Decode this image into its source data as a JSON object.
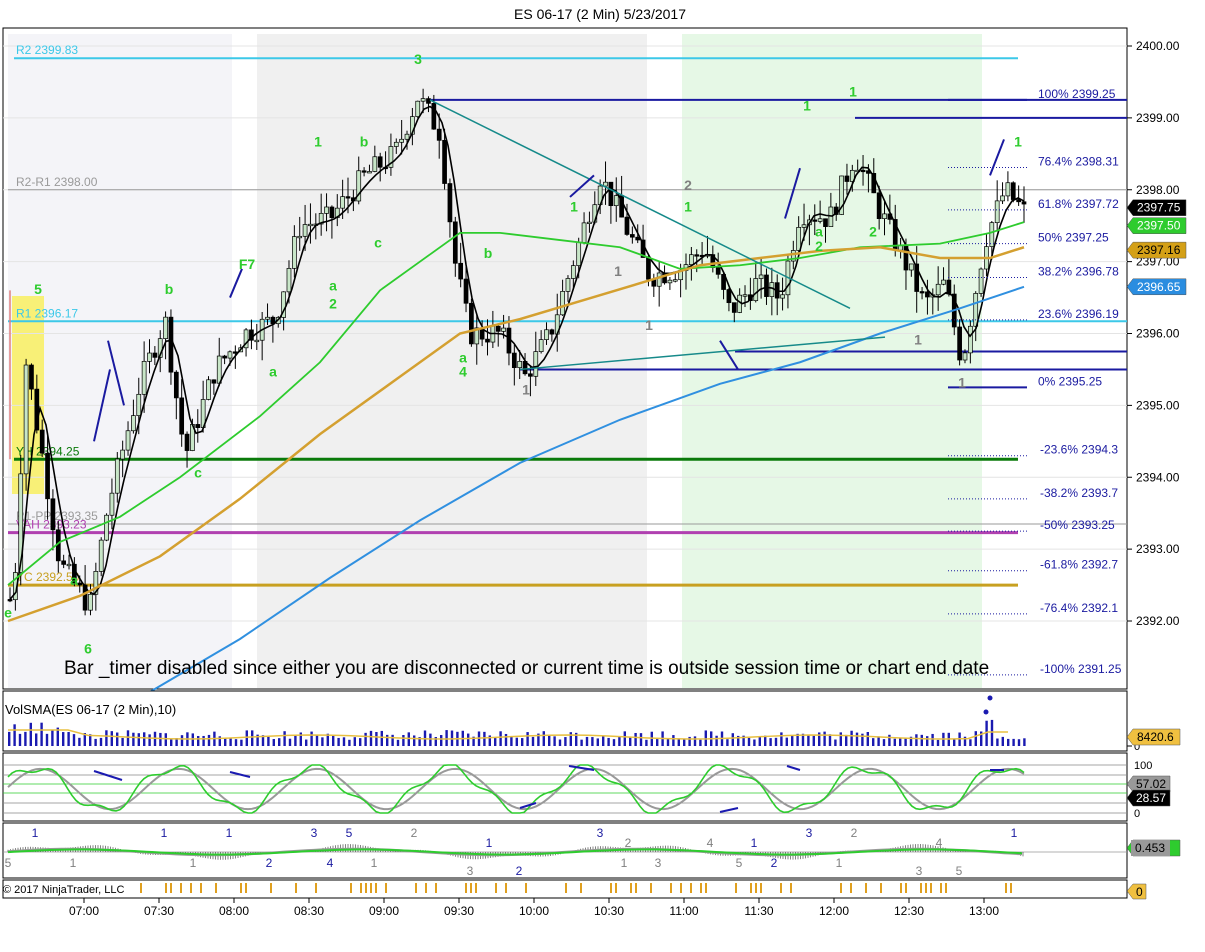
{
  "window": {
    "title": "ES 06-17 (2 Min)  5/23/2017"
  },
  "chart_data": {
    "type": "candlestick",
    "title": "ES 06-17 (2 Min)  5/23/2017",
    "price_axis": {
      "ylim": [
        2390.85,
        2400.3
      ],
      "ticks": [
        "2400.00",
        "2399.00",
        "2398.00",
        "2397.00",
        "2396.00",
        "2395.00",
        "2394.00",
        "2393.00",
        "2392.00"
      ]
    },
    "time_axis": {
      "ticks": [
        "07:00",
        "07:30",
        "08:00",
        "08:30",
        "09:00",
        "09:30",
        "10:00",
        "10:30",
        "11:00",
        "11:30",
        "12:00",
        "12:30",
        "13:00"
      ]
    },
    "levels": [
      {
        "label": "R2 2399.83",
        "price": 2399.83,
        "color": "#3cc8e8"
      },
      {
        "label": "R2-R1 2398.00",
        "price": 2398.0,
        "color": "#9a9a9a"
      },
      {
        "label": "R1 2396.17",
        "price": 2396.17,
        "color": "#3cc8e8"
      },
      {
        "label": "YH 2394.25",
        "price": 2394.25,
        "color": "#0a7a0a"
      },
      {
        "label": "R1-PP 2393.35",
        "price": 2393.35,
        "color": "#9a9a9a"
      },
      {
        "label": "VAH 2393.23",
        "price": 2393.23,
        "color": "#b040b0"
      },
      {
        "label": "YC 2392.50",
        "price": 2392.5,
        "color": "#c8a020"
      }
    ],
    "fibonacci": [
      {
        "label": "100%  2399.25",
        "price": 2399.25
      },
      {
        "label": "76.4%  2398.31",
        "price": 2398.31
      },
      {
        "label": "61.8%  2397.72",
        "price": 2397.72
      },
      {
        "label": "50%  2397.25",
        "price": 2397.25
      },
      {
        "label": "38.2%  2396.78",
        "price": 2396.78
      },
      {
        "label": "23.6%  2396.19",
        "price": 2396.19
      },
      {
        "label": "0%  2395.25",
        "price": 2395.25
      },
      {
        "label": "-23.6%  2394.3",
        "price": 2394.3
      },
      {
        "label": "-38.2%  2393.7",
        "price": 2393.7
      },
      {
        "label": "-50%  2393.25",
        "price": 2393.25
      },
      {
        "label": "-61.8%  2392.7",
        "price": 2392.7
      },
      {
        "label": "-76.4%  2392.1",
        "price": 2392.1
      },
      {
        "label": "-100%  2391.25",
        "price": 2391.25
      }
    ],
    "price_tags": [
      {
        "label": "2397.75",
        "bg": "#000000",
        "fg": "#ffffff",
        "price": 2397.75
      },
      {
        "label": "2397.50",
        "bg": "#2ecc2e",
        "fg": "#ffffff",
        "price": 2397.5
      },
      {
        "label": "2397.16",
        "bg": "#d4a017",
        "fg": "#000000",
        "price": 2397.16
      },
      {
        "label": "2396.65",
        "bg": "#2a8de0",
        "fg": "#ffffff",
        "price": 2396.65
      }
    ],
    "ohlc_path": [
      [
        -2,
        2392.0
      ],
      [
        14,
        2392.4
      ],
      [
        26,
        2395.6
      ],
      [
        40,
        2394.5
      ],
      [
        60,
        2392.8
      ],
      [
        90,
        2392.2
      ],
      [
        108,
        2393.6
      ],
      [
        140,
        2395.3
      ],
      [
        165,
        2396.2
      ],
      [
        185,
        2394.3
      ],
      [
        215,
        2395.5
      ],
      [
        245,
        2396.0
      ],
      [
        275,
        2396.2
      ],
      [
        300,
        2397.5
      ],
      [
        330,
        2397.6
      ],
      [
        365,
        2398.2
      ],
      [
        395,
        2398.5
      ],
      [
        418,
        2399.3
      ],
      [
        440,
        2398.8
      ],
      [
        455,
        2397.0
      ],
      [
        470,
        2396.0
      ],
      [
        500,
        2396.0
      ],
      [
        525,
        2395.4
      ],
      [
        550,
        2396.0
      ],
      [
        580,
        2397.3
      ],
      [
        600,
        2398.2
      ],
      [
        625,
        2397.5
      ],
      [
        650,
        2396.8
      ],
      [
        680,
        2396.9
      ],
      [
        705,
        2397.2
      ],
      [
        730,
        2396.3
      ],
      [
        755,
        2396.7
      ],
      [
        780,
        2396.5
      ],
      [
        800,
        2397.7
      ],
      [
        830,
        2397.6
      ],
      [
        855,
        2398.5
      ],
      [
        880,
        2397.7
      ],
      [
        905,
        2397.0
      ],
      [
        925,
        2396.4
      ],
      [
        945,
        2396.7
      ],
      [
        962,
        2395.6
      ],
      [
        985,
        2397.3
      ],
      [
        1005,
        2398.0
      ],
      [
        1024,
        2397.7
      ]
    ],
    "candle_count": 190,
    "annotations": [
      {
        "text": "3",
        "color": "#2ecc2e",
        "x": 418,
        "y": 2399.75
      },
      {
        "text": "1",
        "color": "#2ecc2e",
        "x": 318,
        "y": 2398.6
      },
      {
        "text": "b",
        "color": "#2ecc2e",
        "x": 364,
        "y": 2398.6
      },
      {
        "text": "c",
        "color": "#2ecc2e",
        "x": 378,
        "y": 2397.2
      },
      {
        "text": "a",
        "color": "#2ecc2e",
        "x": 333,
        "y": 2396.6
      },
      {
        "text": "2",
        "color": "#2ecc2e",
        "x": 333,
        "y": 2396.35
      },
      {
        "text": "a",
        "color": "#2ecc2e",
        "x": 273,
        "y": 2395.4
      },
      {
        "text": "F7",
        "color": "#2ecc2e",
        "x": 247,
        "y": 2396.9
      },
      {
        "text": "b",
        "color": "#2ecc2e",
        "x": 169,
        "y": 2396.55
      },
      {
        "text": "c",
        "color": "#2ecc2e",
        "x": 198,
        "y": 2394.0
      },
      {
        "text": "5",
        "color": "#2ecc2e",
        "x": 38,
        "y": 2396.55
      },
      {
        "text": "a",
        "color": "#2ecc2e",
        "x": 74,
        "y": 2392.5
      },
      {
        "text": "6",
        "color": "#2ecc2e",
        "x": 88,
        "y": 2391.55
      },
      {
        "text": "e",
        "color": "#2ecc2e",
        "x": 8,
        "y": 2392.05
      },
      {
        "text": "b",
        "color": "#2ecc2e",
        "x": 488,
        "y": 2397.05
      },
      {
        "text": "a",
        "color": "#2ecc2e",
        "x": 463,
        "y": 2395.6
      },
      {
        "text": "4",
        "color": "#2ecc2e",
        "x": 463,
        "y": 2395.4
      },
      {
        "text": "1",
        "color": "#2ecc2e",
        "x": 574,
        "y": 2397.7
      },
      {
        "text": "2",
        "color": "#808080",
        "x": 688,
        "y": 2398.0
      },
      {
        "text": "1",
        "color": "#2ecc2e",
        "x": 688,
        "y": 2397.7
      },
      {
        "text": "1",
        "color": "#808080",
        "x": 618,
        "y": 2396.8
      },
      {
        "text": "1",
        "color": "#808080",
        "x": 649,
        "y": 2396.05
      },
      {
        "text": "1",
        "color": "#808080",
        "x": 526,
        "y": 2395.15
      },
      {
        "text": "1",
        "color": "#2ecc2e",
        "x": 807,
        "y": 2399.1
      },
      {
        "text": "1",
        "color": "#2ecc2e",
        "x": 853,
        "y": 2399.3
      },
      {
        "text": "a",
        "color": "#2ecc2e",
        "x": 819,
        "y": 2397.35
      },
      {
        "text": "2",
        "color": "#2ecc2e",
        "x": 819,
        "y": 2397.15
      },
      {
        "text": "2",
        "color": "#2ecc2e",
        "x": 873,
        "y": 2397.35
      },
      {
        "text": "1",
        "color": "#808080",
        "x": 918,
        "y": 2395.85
      },
      {
        "text": "1",
        "color": "#808080",
        "x": 962,
        "y": 2395.25
      },
      {
        "text": "1",
        "color": "#2ecc2e",
        "x": 1018,
        "y": 2398.6
      }
    ],
    "message": "Bar _timer disabled since either you are disconnected or current time is outside session time or chart end date",
    "volume_panel": {
      "title": "VolSMA(ES 06-17 (2 Min),10)",
      "value_tag": "8420.6",
      "ticks": [
        "0"
      ]
    },
    "stochastic_panel": {
      "ticks": [
        "100",
        "0"
      ],
      "tags": [
        "57.02",
        "28.57"
      ]
    },
    "wave_panel": {
      "tag": "0.453",
      "labels": [
        {
          "text": "5",
          "color": "#808080",
          "x": 8,
          "row": "low"
        },
        {
          "text": "1",
          "color": "#1a1aa0",
          "x": 35,
          "row": "top"
        },
        {
          "text": "1",
          "color": "#808080",
          "x": 73,
          "row": "low"
        },
        {
          "text": "1",
          "color": "#1a1aa0",
          "x": 164,
          "row": "top"
        },
        {
          "text": "1",
          "color": "#808080",
          "x": 193,
          "row": "low"
        },
        {
          "text": "1",
          "color": "#1a1aa0",
          "x": 229,
          "row": "top"
        },
        {
          "text": "2",
          "color": "#1a1aa0",
          "x": 269,
          "row": "low"
        },
        {
          "text": "3",
          "color": "#1a1aa0",
          "x": 314,
          "row": "top"
        },
        {
          "text": "4",
          "color": "#1a1aa0",
          "x": 330,
          "row": "low"
        },
        {
          "text": "5",
          "color": "#1a1aa0",
          "x": 349,
          "row": "top"
        },
        {
          "text": "1",
          "color": "#808080",
          "x": 374,
          "row": "low"
        },
        {
          "text": "2",
          "color": "#808080",
          "x": 414,
          "row": "top"
        },
        {
          "text": "3",
          "color": "#808080",
          "x": 470,
          "row": "bottom"
        },
        {
          "text": "1",
          "color": "#1a1aa0",
          "x": 489,
          "row": "mid"
        },
        {
          "text": "2",
          "color": "#1a1aa0",
          "x": 519,
          "row": "bottom"
        },
        {
          "text": "3",
          "color": "#1a1aa0",
          "x": 600,
          "row": "top"
        },
        {
          "text": "2",
          "color": "#808080",
          "x": 628,
          "row": "mid"
        },
        {
          "text": "1",
          "color": "#808080",
          "x": 624,
          "row": "low"
        },
        {
          "text": "3",
          "color": "#808080",
          "x": 658,
          "row": "low"
        },
        {
          "text": "4",
          "color": "#808080",
          "x": 710,
          "row": "mid"
        },
        {
          "text": "5",
          "color": "#808080",
          "x": 739,
          "row": "low"
        },
        {
          "text": "1",
          "color": "#1a1aa0",
          "x": 754,
          "row": "mid"
        },
        {
          "text": "2",
          "color": "#1a1aa0",
          "x": 774,
          "row": "low"
        },
        {
          "text": "3",
          "color": "#1a1aa0",
          "x": 809,
          "row": "top"
        },
        {
          "text": "2",
          "color": "#808080",
          "x": 854,
          "row": "top"
        },
        {
          "text": "1",
          "color": "#808080",
          "x": 839,
          "row": "low"
        },
        {
          "text": "4",
          "color": "#808080",
          "x": 939,
          "row": "mid"
        },
        {
          "text": "3",
          "color": "#808080",
          "x": 919,
          "row": "bottom"
        },
        {
          "text": "5",
          "color": "#808080",
          "x": 959,
          "row": "bottom"
        },
        {
          "text": "1",
          "color": "#1a1aa0",
          "x": 1014,
          "row": "top"
        }
      ]
    },
    "event_panel": {
      "tag": "0"
    }
  },
  "footer": {
    "copyright": "© 2017 NinjaTrader, LLC"
  },
  "colors": {
    "session_gray": "#f0f0f0",
    "session_green": "#e6f8e6",
    "yellow_box": "#f8ee60",
    "sma_black": "#000000",
    "sma_green": "#2ecc2e",
    "sma_orange": "#d4a030",
    "sma_blue": "#3090e0",
    "fib_blue": "#1a1aa0",
    "trend_teal": "#168a8a"
  }
}
